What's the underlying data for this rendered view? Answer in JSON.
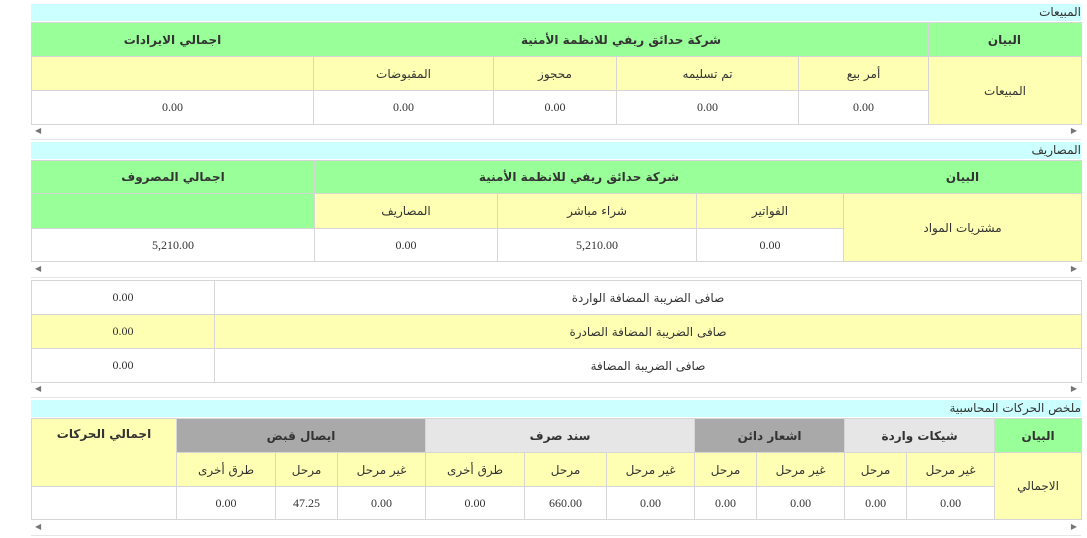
{
  "sales": {
    "section_title": "المبيعات",
    "header_label": "البيان",
    "company": "شركة حدائق ريفي للانظمة الأمنية",
    "total_header": "اجمالي الايرادات",
    "row_label": "المبيعات",
    "sub_headers": [
      "أمر بيع",
      "تم تسليمه",
      "محجوز",
      "المقبوضات"
    ],
    "values": [
      "0.00",
      "0.00",
      "0.00",
      "0.00"
    ],
    "total_value": "0.00"
  },
  "expenses": {
    "section_title": "المصاريف",
    "header_label": "البيان",
    "company": "شركة حدائق ريفي للانظمة الأمنية",
    "total_header": "اجمالي المصروف",
    "row_label": "مشتريات المواد",
    "sub_headers": [
      "الفواتير",
      "شراء مباشر",
      "المصاريف"
    ],
    "values": [
      "0.00",
      "5,210.00",
      "0.00"
    ],
    "total_value": "5,210.00"
  },
  "vat": {
    "rows": [
      {
        "label": "صافى الضريبة المضافة الواردة",
        "value": "0.00"
      },
      {
        "label": "صافى الضريبة المضافة الصادرة",
        "value": "0.00"
      },
      {
        "label": "صافى الضريبة المضافة",
        "value": "0.00"
      }
    ]
  },
  "summary": {
    "section_title": "ملخص الحركات المحاسبية",
    "header_label": "البيان",
    "groups": [
      "شيكات واردة",
      "اشعار دائن",
      "سند صرف",
      "ايصال قبض"
    ],
    "total_header": "اجمالي الحركات",
    "row_label": "الاجمالي",
    "sub": {
      "unposted": "غير مرحل",
      "posted": "مرحل",
      "other": "طرق أخرى"
    },
    "values": {
      "cheques_unposted": "0.00",
      "cheques_posted": "0.00",
      "credit_unposted": "0.00",
      "credit_posted": "0.00",
      "payment_unposted": "0.00",
      "payment_posted": "660.00",
      "payment_other": "0.00",
      "receipt_unposted": "0.00",
      "receipt_posted": "47.25",
      "receipt_other": "0.00"
    },
    "total_value": ""
  },
  "scroll": {
    "left_arrow": "◀",
    "right_arrow": "▶"
  }
}
